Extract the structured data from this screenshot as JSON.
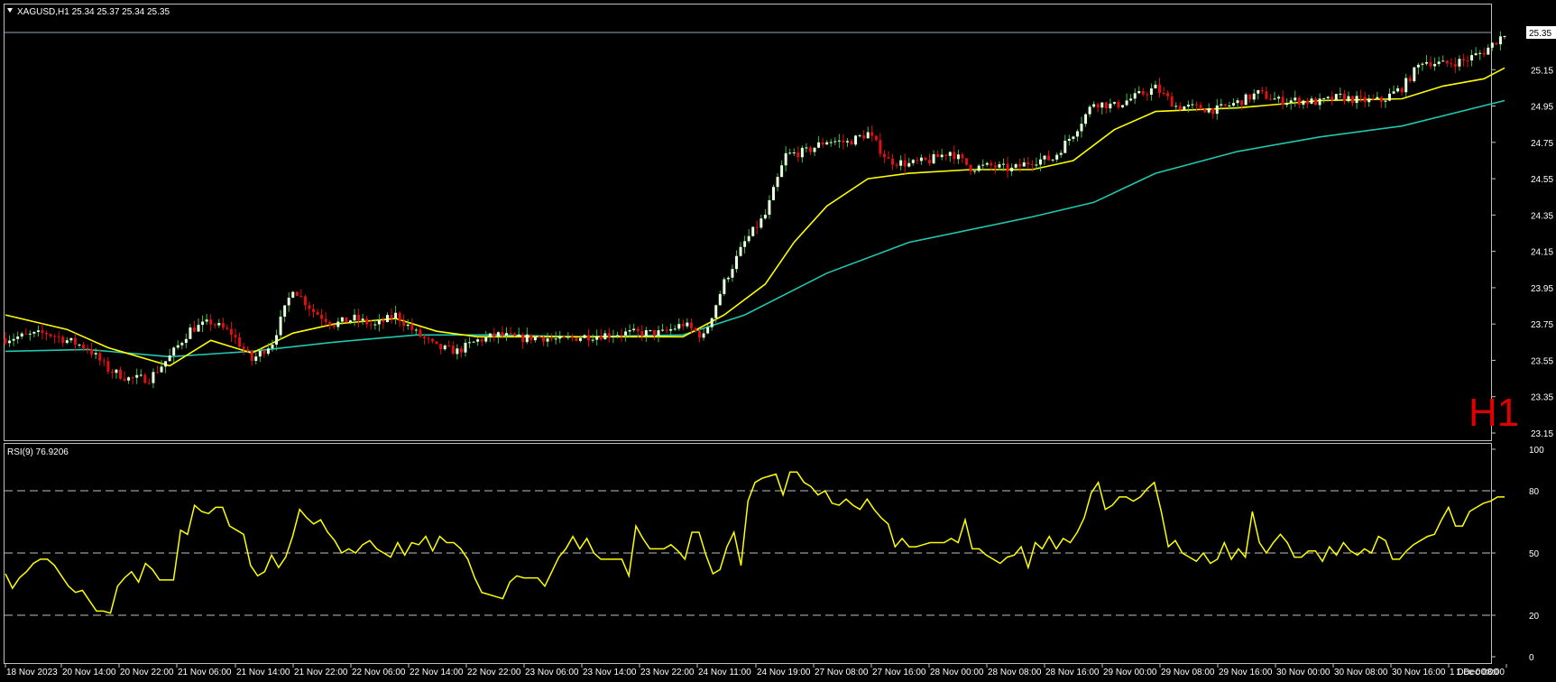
{
  "chart_data": [
    {
      "type": "candlestick",
      "symbol_header": "XAGUSD,H1  25.34 25.37 25.34 25.35",
      "timeframe_badge": "H1",
      "current_price_label": "25.35",
      "current_price": 25.35,
      "y_ticks": [
        "25.35",
        "25.15",
        "24.95",
        "24.75",
        "24.55",
        "24.35",
        "24.15",
        "23.95",
        "23.75",
        "23.55",
        "23.35",
        "23.15"
      ],
      "ylim": [
        23.12,
        25.45
      ],
      "x_ticks": [
        "18 Nov 2023",
        "20 Nov 14:00",
        "20 Nov 22:00",
        "21 Nov 06:00",
        "21 Nov 14:00",
        "21 Nov 22:00",
        "22 Nov 06:00",
        "22 Nov 14:00",
        "22 Nov 22:00",
        "23 Nov 06:00",
        "23 Nov 14:00",
        "23 Nov 22:00",
        "24 Nov 11:00",
        "24 Nov 19:00",
        "27 Nov 08:00",
        "27 Nov 16:00",
        "28 Nov 00:00",
        "28 Nov 08:00",
        "28 Nov 16:00",
        "29 Nov 00:00",
        "29 Nov 08:00",
        "29 Nov 16:00",
        "30 Nov 00:00",
        "30 Nov 08:00",
        "30 Nov 16:00",
        "1 Dec 00:00",
        "1 Dec 08:00"
      ],
      "close_path": [
        [
          0,
          23.67
        ],
        [
          10,
          23.7
        ],
        [
          20,
          23.62
        ],
        [
          25,
          23.5
        ],
        [
          30,
          23.45
        ],
        [
          35,
          23.45
        ],
        [
          40,
          23.57
        ],
        [
          45,
          23.72
        ],
        [
          50,
          23.76
        ],
        [
          55,
          23.7
        ],
        [
          60,
          23.55
        ],
        [
          65,
          23.65
        ],
        [
          70,
          23.95
        ],
        [
          75,
          23.82
        ],
        [
          80,
          23.75
        ],
        [
          85,
          23.78
        ],
        [
          90,
          23.74
        ],
        [
          95,
          23.8
        ],
        [
          100,
          23.7
        ],
        [
          105,
          23.62
        ],
        [
          110,
          23.6
        ],
        [
          115,
          23.66
        ],
        [
          120,
          23.69
        ],
        [
          125,
          23.67
        ],
        [
          130,
          23.68
        ],
        [
          135,
          23.66
        ],
        [
          140,
          23.68
        ],
        [
          150,
          23.7
        ],
        [
          160,
          23.7
        ],
        [
          165,
          23.75
        ],
        [
          170,
          23.68
        ],
        [
          175,
          23.98
        ],
        [
          180,
          24.2
        ],
        [
          185,
          24.35
        ],
        [
          190,
          24.68
        ],
        [
          195,
          24.7
        ],
        [
          200,
          24.76
        ],
        [
          205,
          24.75
        ],
        [
          210,
          24.8
        ],
        [
          215,
          24.65
        ],
        [
          220,
          24.63
        ],
        [
          225,
          24.65
        ],
        [
          230,
          24.7
        ],
        [
          235,
          24.61
        ],
        [
          240,
          24.62
        ],
        [
          245,
          24.6
        ],
        [
          250,
          24.65
        ],
        [
          255,
          24.66
        ],
        [
          260,
          24.8
        ],
        [
          265,
          24.97
        ],
        [
          270,
          24.95
        ],
        [
          275,
          25.0
        ],
        [
          280,
          25.05
        ],
        [
          285,
          24.95
        ],
        [
          290,
          24.94
        ],
        [
          295,
          24.93
        ],
        [
          300,
          24.97
        ],
        [
          305,
          25.02
        ],
        [
          310,
          24.98
        ],
        [
          315,
          24.98
        ],
        [
          320,
          24.97
        ],
        [
          325,
          25.0
        ],
        [
          330,
          24.98
        ],
        [
          335,
          24.98
        ],
        [
          340,
          25.05
        ],
        [
          345,
          25.2
        ],
        [
          350,
          25.18
        ],
        [
          355,
          25.2
        ],
        [
          360,
          25.25
        ],
        [
          365,
          25.35
        ]
      ],
      "series": [
        {
          "name": "",
          "color": "#ffff00",
          "kind": "fast MA",
          "points": [
            [
              0,
              23.8
            ],
            [
              15,
              23.72
            ],
            [
              25,
              23.62
            ],
            [
              40,
              23.52
            ],
            [
              50,
              23.66
            ],
            [
              60,
              23.59
            ],
            [
              70,
              23.7
            ],
            [
              80,
              23.75
            ],
            [
              95,
              23.78
            ],
            [
              105,
              23.71
            ],
            [
              115,
              23.68
            ],
            [
              135,
              23.68
            ],
            [
              165,
              23.68
            ],
            [
              175,
              23.8
            ],
            [
              185,
              23.97
            ],
            [
              192,
              24.2
            ],
            [
              200,
              24.4
            ],
            [
              210,
              24.55
            ],
            [
              220,
              24.58
            ],
            [
              235,
              24.6
            ],
            [
              250,
              24.6
            ],
            [
              260,
              24.65
            ],
            [
              270,
              24.82
            ],
            [
              280,
              24.92
            ],
            [
              300,
              24.94
            ],
            [
              320,
              24.98
            ],
            [
              340,
              24.99
            ],
            [
              350,
              25.06
            ],
            [
              360,
              25.1
            ],
            [
              365,
              25.16
            ]
          ]
        },
        {
          "name": "",
          "color": "#20c8b0",
          "kind": "slow MA",
          "points": [
            [
              0,
              23.6
            ],
            [
              20,
              23.61
            ],
            [
              40,
              23.57
            ],
            [
              60,
              23.6
            ],
            [
              80,
              23.65
            ],
            [
              100,
              23.69
            ],
            [
              120,
              23.69
            ],
            [
              140,
              23.68
            ],
            [
              165,
              23.69
            ],
            [
              180,
              23.8
            ],
            [
              200,
              24.03
            ],
            [
              220,
              24.2
            ],
            [
              250,
              24.34
            ],
            [
              265,
              24.42
            ],
            [
              280,
              24.58
            ],
            [
              300,
              24.7
            ],
            [
              320,
              24.78
            ],
            [
              340,
              24.84
            ],
            [
              365,
              24.98
            ]
          ]
        }
      ]
    },
    {
      "type": "line",
      "header": "RSI(9) 76.9206",
      "ylim": [
        0,
        100
      ],
      "y_ticks": [
        "100",
        "80",
        "50",
        "20",
        "0"
      ],
      "levels": [
        80,
        50,
        20
      ],
      "color": "#ffff00",
      "values": [
        40,
        33,
        38,
        41,
        45,
        47,
        47,
        44,
        39,
        34,
        31,
        32,
        27,
        22,
        22,
        21,
        34,
        38,
        41,
        36,
        45,
        42,
        37,
        37,
        37,
        61,
        59,
        73,
        70,
        69,
        72,
        72,
        63,
        61,
        59,
        44,
        39,
        41,
        49,
        43,
        48,
        58,
        71,
        67,
        64,
        66,
        60,
        56,
        50,
        52,
        50,
        54,
        56,
        52,
        50,
        48,
        55,
        49,
        55,
        54,
        58,
        51,
        58,
        55,
        55,
        52,
        47,
        38,
        31,
        30,
        29,
        28,
        36,
        39,
        38,
        38,
        38,
        34,
        41,
        48,
        52,
        58,
        52,
        57,
        50,
        47,
        47,
        47,
        47,
        39,
        63,
        57,
        52,
        52,
        52,
        54,
        51,
        47,
        60,
        60,
        49,
        40,
        42,
        53,
        60,
        44,
        75,
        84,
        86,
        87,
        88,
        78,
        89,
        89,
        84,
        82,
        78,
        80,
        74,
        73,
        76,
        73,
        71,
        76,
        71,
        67,
        64,
        53,
        57,
        53,
        53,
        54,
        55,
        55,
        55,
        57,
        55,
        66,
        52,
        52,
        49,
        47,
        45,
        48,
        49,
        53,
        43,
        55,
        52,
        58,
        52,
        57,
        55,
        60,
        67,
        79,
        84,
        71,
        73,
        77,
        77,
        75,
        77,
        81,
        84,
        70,
        53,
        56,
        50,
        48,
        46,
        50,
        45,
        47,
        55,
        47,
        52,
        48,
        70,
        55,
        50,
        55,
        59,
        55,
        48,
        48,
        51,
        51,
        46,
        53,
        49,
        55,
        51,
        49,
        52,
        50,
        58,
        56,
        47,
        47,
        51,
        54,
        56,
        58,
        59,
        66,
        72,
        63,
        63,
        70,
        72,
        74,
        75,
        77,
        77
      ]
    }
  ]
}
